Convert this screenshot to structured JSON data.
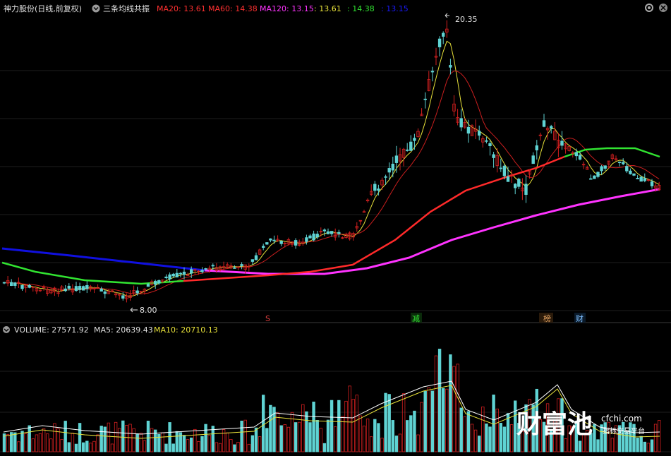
{
  "header": {
    "stock_name": "神力股份(日线,前复权)",
    "indicator_name": "三条均线共振",
    "ma20_label": "MA20: 13.61",
    "ma60_label": "MA60: 14.38",
    "ma120_label": "MA120: 13.15",
    "extra_value_1": ": 13.61",
    "extra_value_2": ": 14.38",
    "extra_value_3": ": 13.15"
  },
  "volume_header": {
    "volume_label": "VOLUME: 27571.92",
    "ma5_label": "MA5: 20639.43",
    "ma10_label": "MA10: 20710.13"
  },
  "price_annotations": {
    "high_label": "20.35",
    "low_label": "8.00"
  },
  "event_markers": [
    {
      "text": "S"
    },
    {
      "text": "减"
    },
    {
      "text": "榜"
    },
    {
      "text": "财"
    }
  ],
  "watermark": {
    "brand_text": "财富池",
    "domain_text": "cfchi.com",
    "tagline": "指标交易平台"
  },
  "colors": {
    "background": "#000000",
    "grid": "#1e1e1e",
    "up_candle": "#d42020",
    "down_candle": "#5fd3d3",
    "ma20": "#ff2a2a",
    "ma60": "#ffffff",
    "ma120": "#ff33ff",
    "ma_short_yellow": "#e8e23a",
    "ma_green": "#31e331",
    "ma_blue": "#1010e0",
    "ma10_red_thin": "#c81e1e"
  }
}
